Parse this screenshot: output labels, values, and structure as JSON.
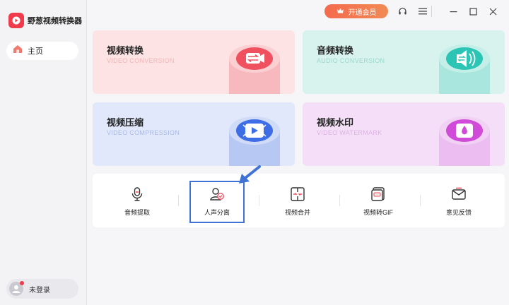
{
  "app": {
    "title": "野葱视频转换器"
  },
  "sidebar": {
    "home_label": "主页",
    "login_label": "未登录"
  },
  "titlebar": {
    "vip_label": "开通会员",
    "icons": [
      "crown-icon",
      "headset-icon",
      "menu-icon",
      "minimize-icon",
      "maximize-icon",
      "close-icon"
    ]
  },
  "cards": [
    {
      "title": "视频转换",
      "subtitle": "VIDEO CONVERSION",
      "icon": "video-convert-icon",
      "color": "#f0515f"
    },
    {
      "title": "音频转换",
      "subtitle": "AUDIO CONVERSION",
      "icon": "audio-convert-icon",
      "color": "#2cc4b4"
    },
    {
      "title": "视频压缩",
      "subtitle": "VIDEO COMPRESSION",
      "icon": "video-compress-icon",
      "color": "#3d6ee6"
    },
    {
      "title": "视频水印",
      "subtitle": "VIDEO WATERMARK",
      "icon": "video-watermark-icon",
      "color": "#d04bd8"
    }
  ],
  "tools": [
    {
      "label": "音频提取",
      "icon": "microphone-icon"
    },
    {
      "label": "人声分离",
      "icon": "voice-separation-icon"
    },
    {
      "label": "视频合并",
      "icon": "video-merge-icon"
    },
    {
      "label": "视频转GIF",
      "icon": "gif-icon"
    },
    {
      "label": "意见反馈",
      "icon": "feedback-mail-icon"
    }
  ]
}
